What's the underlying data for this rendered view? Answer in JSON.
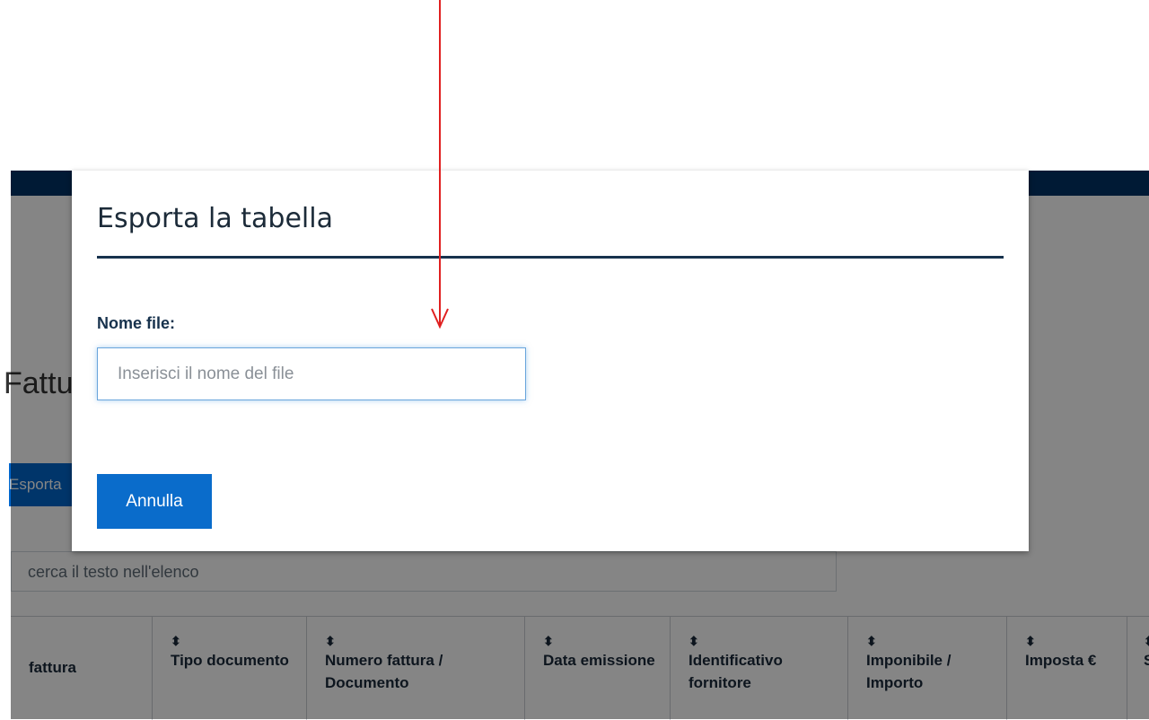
{
  "background": {
    "page_title": "Fatture",
    "export_button": "Esporta",
    "search_placeholder": "cerca il testo nell'elenco",
    "table_headers": [
      "fattura",
      "Tipo documento",
      "Numero fattura / Documento",
      "Data emissione",
      "Identificativo fornitore",
      "Imponibile / Importo",
      "Imposta €",
      "S"
    ],
    "sort_icon": "sort-icon"
  },
  "modal": {
    "title": "Esporta la tabella",
    "file_label": "Nome file:",
    "file_placeholder": "Inserisci il nome del file",
    "file_value": "",
    "cancel_label": "Annulla"
  },
  "annotation": {
    "arrow_color": "#e02020"
  },
  "colors": {
    "primary": "#0a6ccb",
    "header_bar": "#003366",
    "title_rule": "#17324d"
  }
}
